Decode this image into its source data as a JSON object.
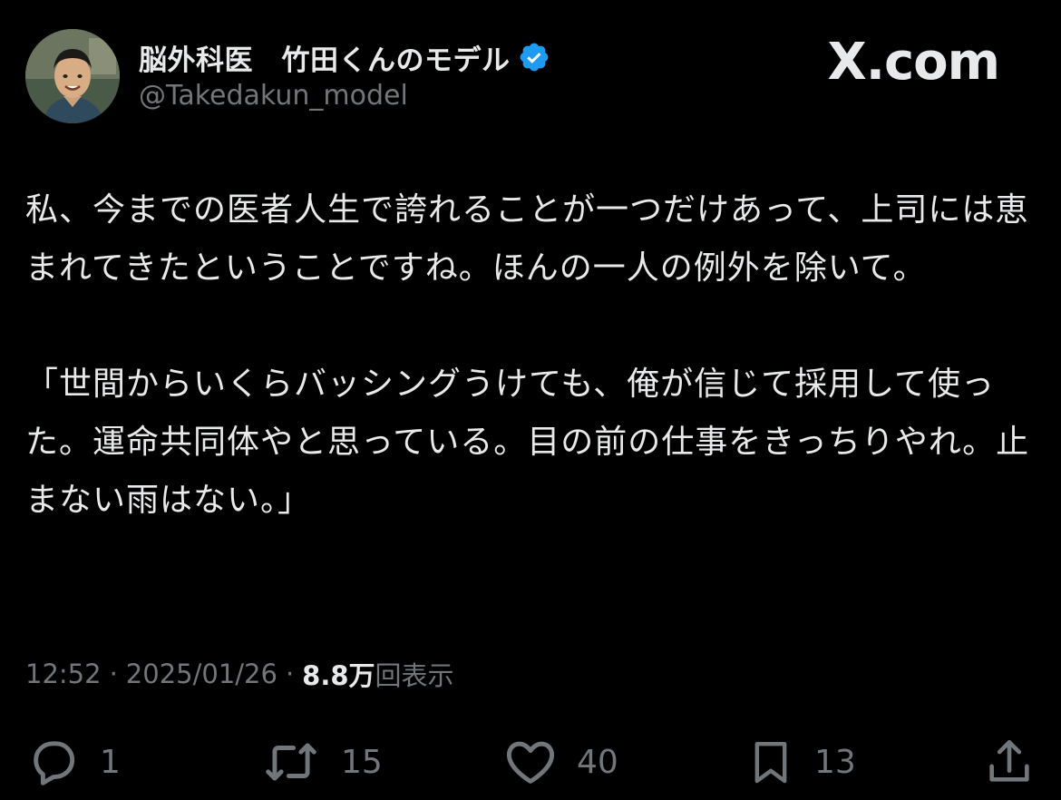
{
  "author": {
    "display_name": "脳外科医　竹田くんのモデル",
    "handle": "@Takedakun_model",
    "verified": true
  },
  "brand": {
    "label": "X.com"
  },
  "tweet": {
    "paragraph_1": "私、今までの医者人生で誇れることが一つだけあって、上司には恵まれてきたということですね。ほんの一人の例外を除いて。",
    "paragraph_2": "「世間からいくらバッシングうけても、俺が信じて採用して使った。運命共同体やと思っている。目の前の仕事をきっちりやれ。止まない雨はない。」"
  },
  "meta": {
    "time": "12:52",
    "date": "2025/01/26",
    "views_count": "8.8万",
    "views_label": "回表示"
  },
  "actions": {
    "replies": "1",
    "reposts": "15",
    "likes": "40",
    "bookmarks": "13"
  },
  "colors": {
    "background": "#000000",
    "text": "#e7e9ea",
    "secondary": "#71767b",
    "verified": "#1d9bf0"
  }
}
